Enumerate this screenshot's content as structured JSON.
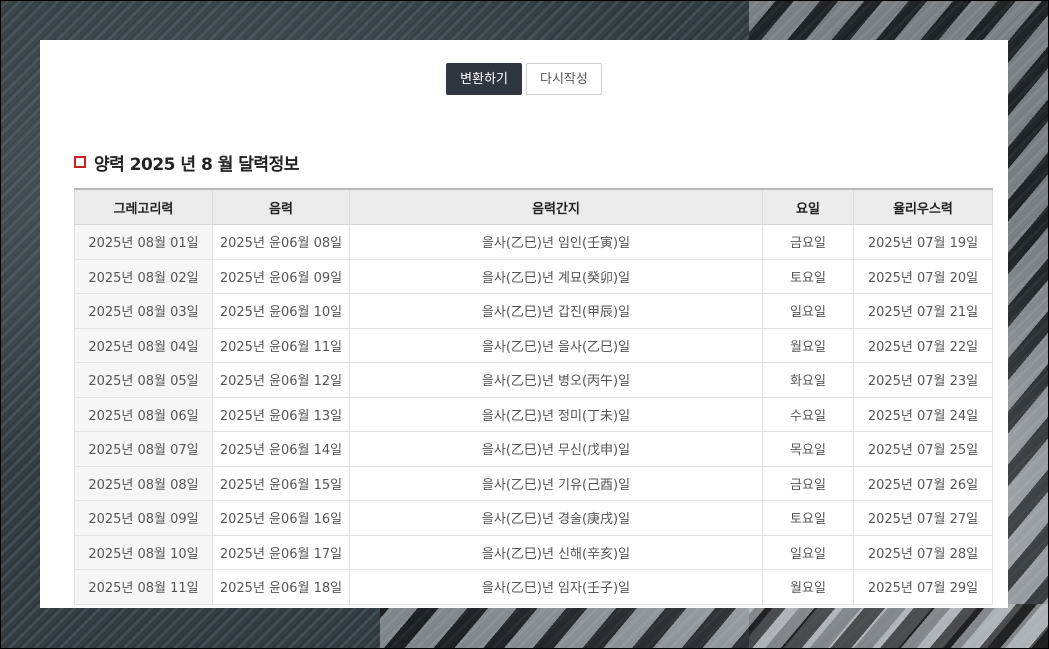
{
  "buttons": {
    "convert": "변환하기",
    "reset": "다시작성"
  },
  "section": {
    "title": "양력 2025 년 8 월 달력정보"
  },
  "colors": {
    "accent": "#d11f1f",
    "primary_button": "#2f3640"
  },
  "table": {
    "headers": [
      "그레고리력",
      "음력",
      "음력간지",
      "요일",
      "율리우스력"
    ],
    "rows": [
      [
        "2025년 08월 01일",
        "2025년 윤06월 08일",
        "을사(乙巳)년 임인(壬寅)일",
        "금요일",
        "2025년 07월 19일"
      ],
      [
        "2025년 08월 02일",
        "2025년 윤06월 09일",
        "을사(乙巳)년 계묘(癸卯)일",
        "토요일",
        "2025년 07월 20일"
      ],
      [
        "2025년 08월 03일",
        "2025년 윤06월 10일",
        "을사(乙巳)년 갑진(甲辰)일",
        "일요일",
        "2025년 07월 21일"
      ],
      [
        "2025년 08월 04일",
        "2025년 윤06월 11일",
        "을사(乙巳)년 을사(乙巳)일",
        "월요일",
        "2025년 07월 22일"
      ],
      [
        "2025년 08월 05일",
        "2025년 윤06월 12일",
        "을사(乙巳)년 병오(丙午)일",
        "화요일",
        "2025년 07월 23일"
      ],
      [
        "2025년 08월 06일",
        "2025년 윤06월 13일",
        "을사(乙巳)년 정미(丁未)일",
        "수요일",
        "2025년 07월 24일"
      ],
      [
        "2025년 08월 07일",
        "2025년 윤06월 14일",
        "을사(乙巳)년 무신(戊申)일",
        "목요일",
        "2025년 07월 25일"
      ],
      [
        "2025년 08월 08일",
        "2025년 윤06월 15일",
        "을사(乙巳)년 기유(己酉)일",
        "금요일",
        "2025년 07월 26일"
      ],
      [
        "2025년 08월 09일",
        "2025년 윤06월 16일",
        "을사(乙巳)년 경술(庚戌)일",
        "토요일",
        "2025년 07월 27일"
      ],
      [
        "2025년 08월 10일",
        "2025년 윤06월 17일",
        "을사(乙巳)년 신해(辛亥)일",
        "일요일",
        "2025년 07월 28일"
      ],
      [
        "2025년 08월 11일",
        "2025년 윤06월 18일",
        "을사(乙巳)년 임자(壬子)일",
        "월요일",
        "2025년 07월 29일"
      ]
    ]
  }
}
